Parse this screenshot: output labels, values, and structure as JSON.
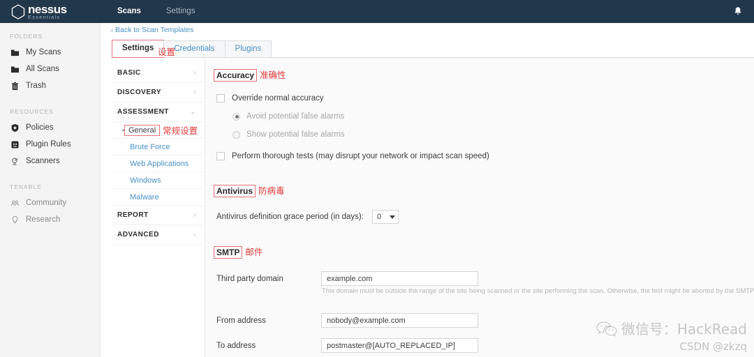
{
  "header": {
    "brand_name": "nessus",
    "brand_sub": "Essentials",
    "nav": [
      {
        "label": "Scans",
        "active": true
      },
      {
        "label": "Settings",
        "active": false
      }
    ],
    "bell_icon": "bell-icon"
  },
  "sidebar": {
    "groups": [
      {
        "title": "FOLDERS",
        "items": [
          {
            "label": "My Scans",
            "icon": "folder-icon"
          },
          {
            "label": "All Scans",
            "icon": "folder-icon"
          },
          {
            "label": "Trash",
            "icon": "trash-icon"
          }
        ]
      },
      {
        "title": "RESOURCES",
        "items": [
          {
            "label": "Policies",
            "icon": "shield-icon"
          },
          {
            "label": "Plugin Rules",
            "icon": "plugin-icon"
          },
          {
            "label": "Scanners",
            "icon": "scanner-icon"
          }
        ]
      },
      {
        "title": "TENABLE",
        "items": [
          {
            "label": "Community",
            "icon": "people-icon"
          },
          {
            "label": "Research",
            "icon": "lightbulb-icon"
          }
        ]
      }
    ]
  },
  "main": {
    "back_link": "Back to Scan Templates",
    "back_chevron": "‹",
    "tabs": [
      {
        "label": "Settings",
        "active": true
      },
      {
        "label": "Credentials",
        "active": false
      },
      {
        "label": "Plugins",
        "active": false
      }
    ],
    "tab_annotation": "设置"
  },
  "settings_nav": [
    {
      "label": "BASIC",
      "type": "group",
      "arrow": "›"
    },
    {
      "label": "DISCOVERY",
      "type": "group",
      "arrow": "›"
    },
    {
      "label": "ASSESSMENT",
      "type": "group",
      "arrow": "⌄",
      "expanded": true
    },
    {
      "label": "General",
      "type": "sub",
      "selected": true,
      "annotation": "常规设置"
    },
    {
      "label": "Brute Force",
      "type": "sub"
    },
    {
      "label": "Web Applications",
      "type": "sub"
    },
    {
      "label": "Windows",
      "type": "sub"
    },
    {
      "label": "Malware",
      "type": "sub"
    },
    {
      "label": "REPORT",
      "type": "group",
      "arrow": "›"
    },
    {
      "label": "ADVANCED",
      "type": "group",
      "arrow": "›"
    }
  ],
  "content": {
    "accuracy": {
      "title": "Accuracy",
      "annotation": "准确性",
      "override_label": "Override normal accuracy",
      "override_checked": false,
      "radio_avoid": "Avoid potential false alarms",
      "radio_show": "Show potential false alarms",
      "radio_selected": "avoid",
      "thorough_label": "Perform thorough tests (may disrupt your network or impact scan speed)",
      "thorough_checked": false
    },
    "antivirus": {
      "title": "Antivirus",
      "annotation": "防病毒",
      "grace_label": "Antivirus definition grace period (in days):",
      "grace_value": "0"
    },
    "smtp": {
      "title": "SMTP",
      "annotation": "邮件",
      "third_party_label": "Third party domain",
      "third_party_value": "example.com",
      "third_party_helper": "This domain must be outside the range of the site being scanned or the site performing the scan. Otherwise, the test might be aborted by the SMTP server.",
      "from_label": "From address",
      "from_value": "nobody@example.com",
      "to_label": "To address",
      "to_value": "postmaster@[AUTO_REPLACED_IP]"
    }
  },
  "watermark": {
    "line1": "微信号：HackRead",
    "line2": "CSDN @zkzq",
    "icon": "wechat-icon"
  },
  "colors": {
    "topbar": "#22374a",
    "link": "#4a90c4",
    "annotation_red": "#e03c3c",
    "panel_bg": "#fafafa"
  }
}
